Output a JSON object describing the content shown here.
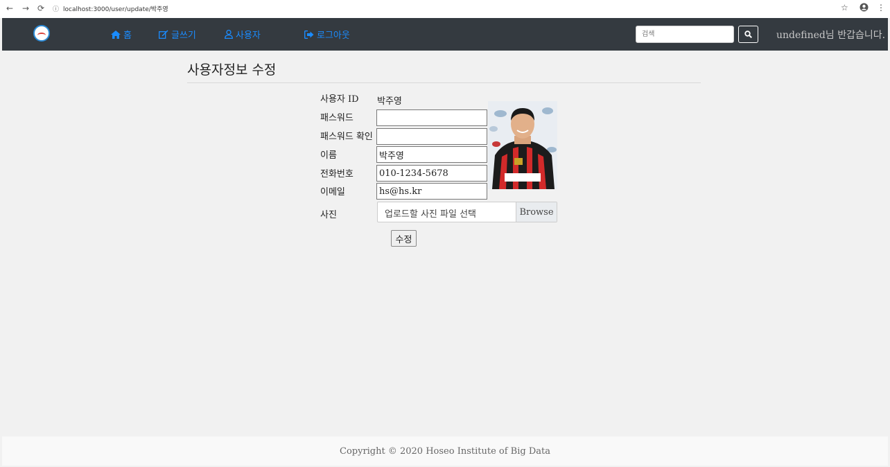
{
  "browser": {
    "url": "localhost:3000/user/update/박주영",
    "icons": [
      "back-icon",
      "forward-icon",
      "reload-icon",
      "info-icon",
      "star-icon",
      "account-icon",
      "menu-icon"
    ]
  },
  "navbar": {
    "links": [
      {
        "icon": "home-icon",
        "glyph": "🏠",
        "label": "홈"
      },
      {
        "icon": "edit-icon",
        "glyph": "✎",
        "label": "글쓰기"
      },
      {
        "icon": "user-icon",
        "glyph": "👤",
        "label": "사용자"
      },
      {
        "icon": "sign-out-icon",
        "glyph": "⇥",
        "label": "로그아웃"
      }
    ],
    "search_placeholder": "검색",
    "greeting": "undefined님 반갑습니다.",
    "link_color": "#1a8cff",
    "bg_color": "#343a40"
  },
  "page": {
    "title": "사용자정보 수정"
  },
  "form": {
    "userid_label": "사용자 ID",
    "userid_value": "박주영",
    "password_label": "패스워드",
    "password_value": "",
    "password_confirm_label": "패스워드 확인",
    "password_confirm_value": "",
    "name_label": "이름",
    "name_value": "박주영",
    "phone_label": "전화번호",
    "phone_value": "010-1234-5678",
    "email_label": "이메일",
    "email_value": "hs@hs.kr",
    "photo_label": "사진",
    "file_placeholder": "업로드할 사진 파일 선택",
    "browse_label": "Browse",
    "submit_label": "수정"
  },
  "footer": {
    "text": "Copyright © 2020 Hoseo Institute of Big Data"
  }
}
